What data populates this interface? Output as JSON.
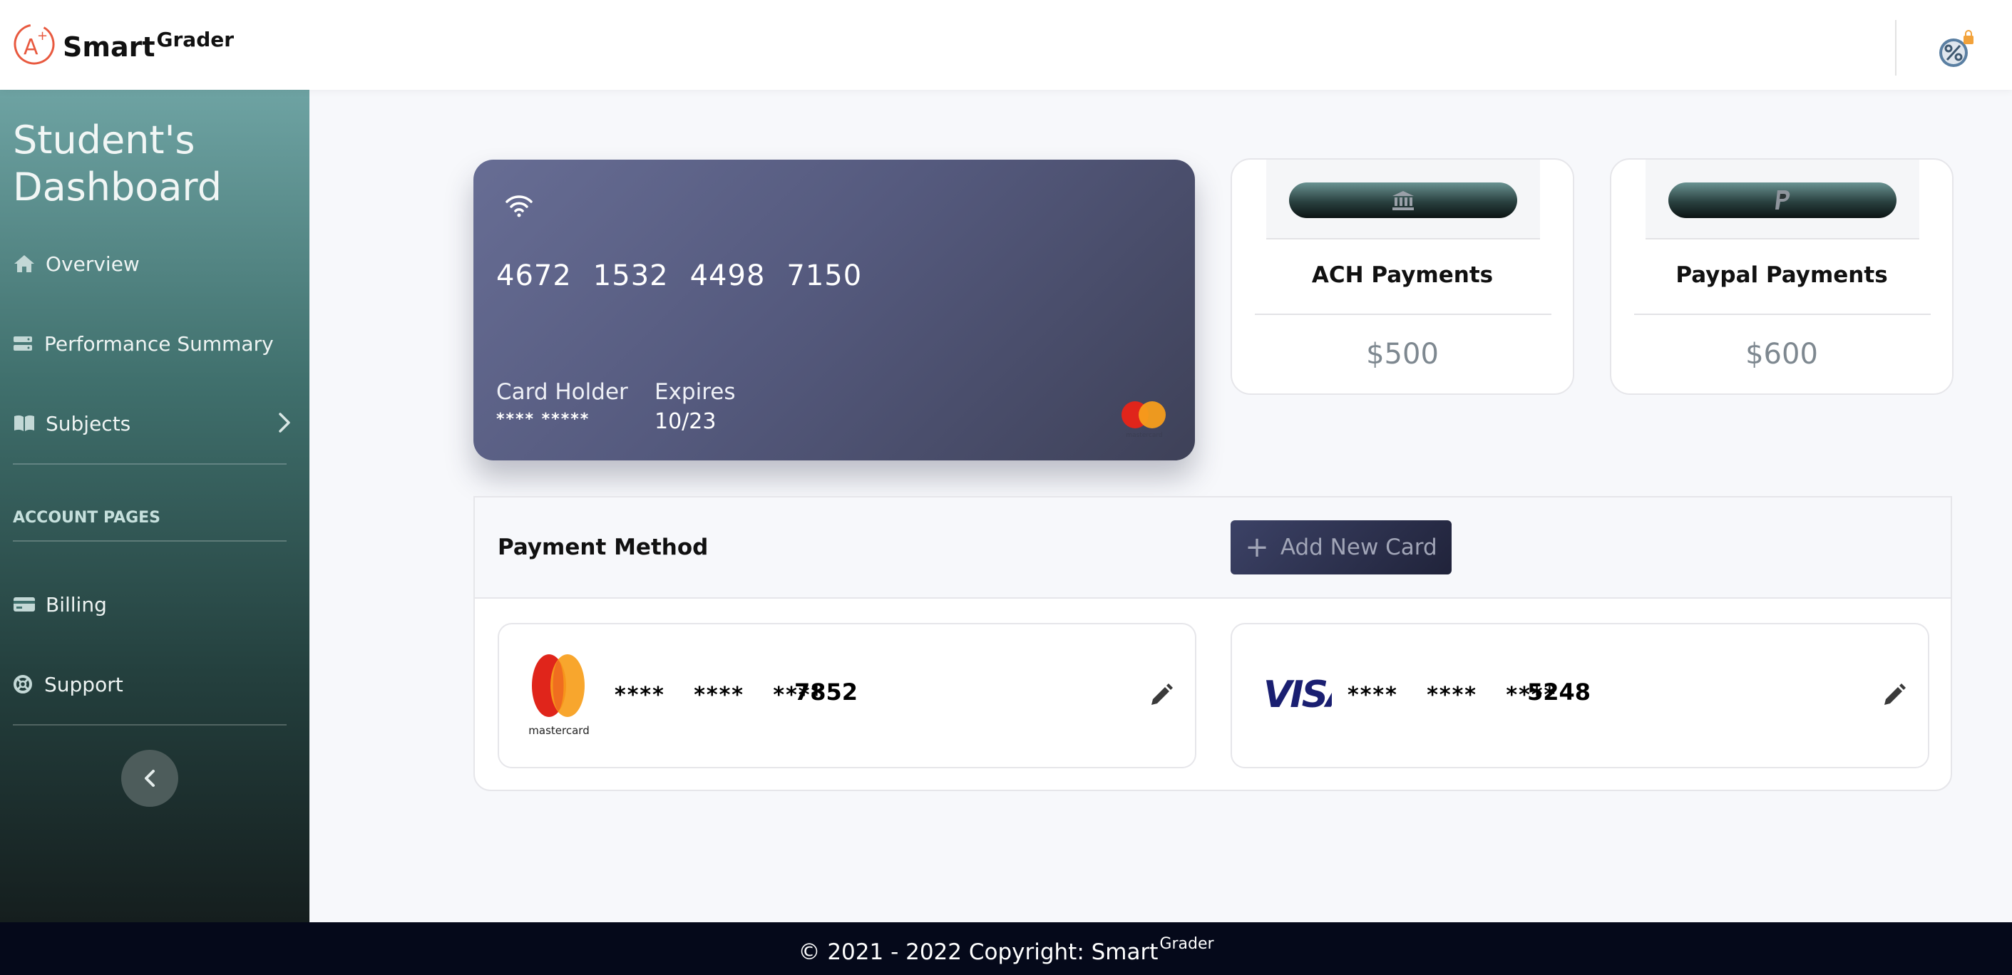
{
  "app": {
    "name": "Smart",
    "name_sup": "Grader"
  },
  "sidebar": {
    "title_line1": "Student's",
    "title_line2": "Dashboard",
    "items": [
      {
        "label": "Overview",
        "icon": "home-icon"
      },
      {
        "label": "Performance Summary",
        "icon": "server-icon"
      },
      {
        "label": "Subjects",
        "icon": "book-icon"
      }
    ],
    "section_label": "ACCOUNT PAGES",
    "account_items": [
      {
        "label": "Billing",
        "icon": "credit-card-icon"
      },
      {
        "label": "Support",
        "icon": "life-ring-icon"
      }
    ]
  },
  "credit_card": {
    "number_groups": [
      "4672",
      "1532",
      "4498",
      "7150"
    ],
    "holder_label": "Card Holder",
    "holder_value": "**** *****",
    "expires_label": "Expires",
    "expires_value": "10/23",
    "brand_text": "mastercard"
  },
  "payments": [
    {
      "title": "ACH Payments",
      "amount": "$500",
      "icon": "bank-icon"
    },
    {
      "title": "Paypal Payments",
      "amount": "$600",
      "icon": "paypal-icon"
    }
  ],
  "payment_method": {
    "title": "Payment Method",
    "add_button": "Add New Card",
    "cards": [
      {
        "brand": "mastercard",
        "mask": "**** **** ****",
        "last4": "7852"
      },
      {
        "brand": "VISA",
        "mask": "**** **** ****",
        "last4": "5248"
      }
    ]
  },
  "footer": {
    "text": "© 2021 - 2022 Copyright: Smart",
    "sup": "Grader"
  },
  "colors": {
    "sidebar_top": "#6ea3a3",
    "sidebar_bottom": "#151e1e",
    "card_gradient_start": "#676d94",
    "card_gradient_end": "#3e4158",
    "footer_bg": "#05091a",
    "mastercard_red": "#e0251b",
    "mastercard_orange": "#f79e1b",
    "visa_blue": "#1a1f71"
  }
}
